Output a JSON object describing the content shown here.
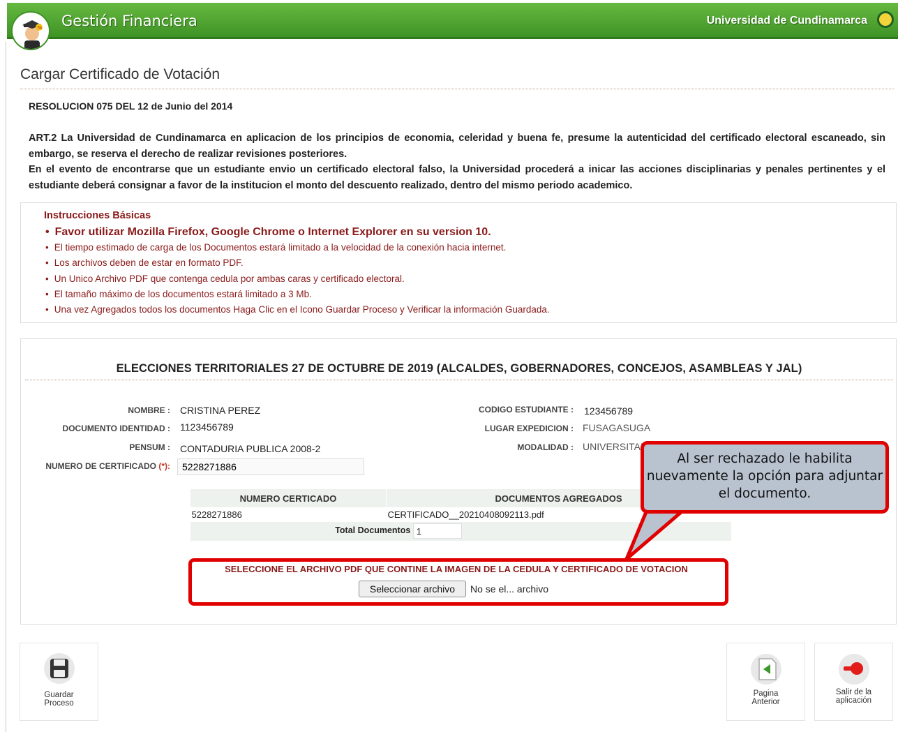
{
  "header": {
    "app_title": "Gestión Financiera",
    "university": "Universidad de Cundinamarca"
  },
  "page": {
    "title": "Cargar Certificado de Votación",
    "resolution": "RESOLUCION 075 DEL 12 de Junio del 2014",
    "article_p1": "ART.2 La Universidad de Cundinamarca en aplicacion de los principios de economia, celeridad y buena fe, presume la autenticidad del certificado electoral escaneado, sin embargo, se reserva el derecho de realizar revisiones posteriores.",
    "article_p2": "En el evento de encontrarse que un estudiante envio un certificado electoral falso, la Universidad procederá a inicar las acciones disciplinarias y penales pertinentes y el estudiante deberá consignar a favor de la institucion el monto del descuento realizado, dentro del mismo periodo academico."
  },
  "instructions": {
    "title": "Instrucciones Básicas",
    "items": [
      "Favor utilizar Mozilla Firefox, Google Chrome o Internet Explorer en su version 10.",
      "El tiempo estimado de carga de los Documentos estará limitado a la velocidad de la conexión hacia internet.",
      "Los archivos deben de estar en formato PDF.",
      "Un Unico Archivo PDF que contenga cedula por ambas caras y certificado electoral.",
      "El tamaño máximo de los documentos estará limitado a 3 Mb.",
      "Una vez Agregados todos los documentos Haga Clic en el Icono Guardar Proceso y Verificar la información Guardada."
    ]
  },
  "election": {
    "title": "ELECCIONES TERRITORIALES 27 DE OCTUBRE DE 2019 (ALCALDES, GOBERNADORES, CONCEJOS, ASAMBLEAS Y JAL)"
  },
  "student": {
    "nombre_label": "NOMBRE :",
    "nombre": "CRISTINA PEREZ",
    "documento_label": "DOCUMENTO IDENTIDAD :",
    "documento": "1123456789",
    "pensum_label": "PENSUM :",
    "pensum": "CONTADURIA PUBLICA 2008-2",
    "certificado_label": "NUMERO DE CERTIFICADO",
    "certificado_req": "(*):",
    "certificado": "5228271886",
    "codigo_label": "CODIGO ESTUDIANTE :",
    "codigo": "123456789",
    "lugar_label": "LUGAR EXPEDICION :",
    "lugar": "FUSAGASUGA",
    "modalidad_label": "MODALIDAD :",
    "modalidad": "UNIVERSITAR"
  },
  "documents_table": {
    "headers": [
      "NUMERO CERTICADO",
      "DOCUMENTOS AGREGADOS"
    ],
    "rows": [
      [
        "5228271886",
        "CERTIFICADO__20210408092113.pdf"
      ]
    ],
    "total_label": "Total Documentos",
    "total_value": "1"
  },
  "upload": {
    "prompt": "SELECCIONE EL ARCHIVO PDF QUE CONTINE LA IMAGEN DE LA CEDULA Y CERTIFICADO DE VOTACION",
    "button": "Seleccionar archivo",
    "status": "No se el... archivo"
  },
  "callout": {
    "text": "Al ser rechazado le habilita nuevamente la opción para adjuntar el documento."
  },
  "actions": {
    "save_line1": "Guardar",
    "save_line2": "Proceso",
    "prev_line1": "Pagina",
    "prev_line2": "Anterior",
    "exit_line1": "Salir de la",
    "exit_line2": "aplicación"
  },
  "colors": {
    "header_green": "#4ea62f",
    "instruction_red": "#8a1a1a",
    "highlight_red": "#e10000",
    "callout_fill": "#b9c3d0"
  }
}
